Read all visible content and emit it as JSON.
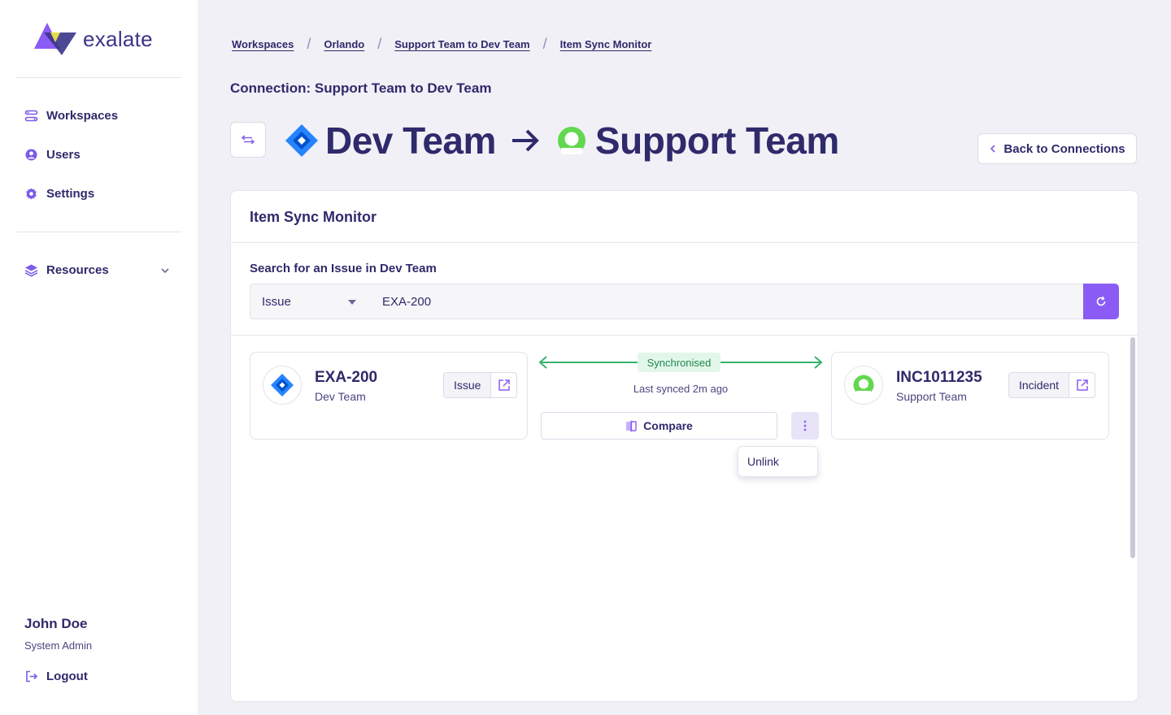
{
  "app": {
    "name": "exalate"
  },
  "sidebar": {
    "items": [
      {
        "label": "Workspaces",
        "icon": "workspaces-icon"
      },
      {
        "label": "Users",
        "icon": "user-circle-icon"
      },
      {
        "label": "Settings",
        "icon": "gear-icon"
      }
    ],
    "resources_label": "Resources",
    "user": {
      "name": "John Doe",
      "role": "System Admin"
    },
    "logout_label": "Logout"
  },
  "breadcrumb": [
    "Workspaces",
    "Orlando",
    "Support Team to Dev Team",
    "Item Sync Monitor"
  ],
  "connection_label": "Connection: Support Team to Dev Team",
  "hero": {
    "source": "Dev Team",
    "target": "Support Team"
  },
  "back_button": "Back to Connections",
  "panel": {
    "title": "Item Sync Monitor",
    "search_label": "Search for an Issue in Dev Team",
    "select_value": "Issue",
    "search_value": "EXA-200"
  },
  "left_card": {
    "key": "EXA-200",
    "team": "Dev Team",
    "type": "Issue"
  },
  "right_card": {
    "key": "INC1011235",
    "team": "Support Team",
    "type": "Incident"
  },
  "sync": {
    "status": "Synchronised",
    "last_synced": "Last synced 2m ago",
    "compare_label": "Compare",
    "menu_item": "Unlink"
  },
  "colors": {
    "accent": "#8a5cf5",
    "text": "#2f2a6b",
    "sync_green": "#37b26c",
    "jira_blue": "#2684ff",
    "snow_green": "#62d84e"
  }
}
